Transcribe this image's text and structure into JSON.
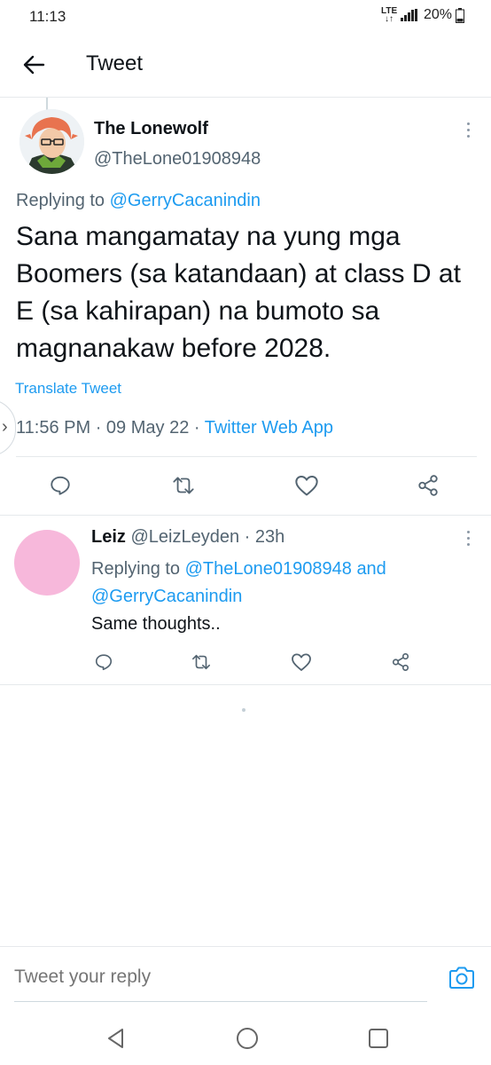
{
  "status_bar": {
    "time": "11:13",
    "network": "LTE",
    "battery": "20%"
  },
  "header": {
    "title": "Tweet",
    "back_icon": "arrow-left-icon"
  },
  "tweet": {
    "author_name": "The Lonewolf",
    "author_handle": "@TheLone01908948",
    "replying_prefix": "Replying to",
    "replying_to": "@GerryCacanindin",
    "text": "Sana mangamatay na yung mga Boomers (sa katandaan) at class D at E (sa kahirapan) na bumoto sa magnanakaw before 2028.",
    "translate_label": "Translate Tweet",
    "time": "11:56 PM",
    "date": "09 May 22",
    "source": "Twitter Web App",
    "separator": "·"
  },
  "reply": {
    "author_name": "Leiz",
    "author_handle": "@LeizLeyden",
    "separator": "·",
    "age": "23h",
    "replying_prefix": "Replying to",
    "replying_to_1": "@TheLone01908948",
    "replying_and": "and",
    "replying_to_2": "@GerryCacanindin",
    "text": "Same thoughts.."
  },
  "composer": {
    "placeholder": "Tweet your reply"
  },
  "colors": {
    "accent": "#1d9bf0",
    "secondary_text": "#536471",
    "primary_text": "#0f1419",
    "divider": "#e6e9ec",
    "reply_avatar": "#f7b8db"
  },
  "icons": {
    "reply": "comment-icon",
    "retweet": "retweet-icon",
    "like": "heart-icon",
    "share": "share-icon",
    "more": "more-vertical-icon",
    "camera": "camera-icon",
    "nav_back": "nav-back-triangle-icon",
    "nav_home": "nav-home-circle-icon",
    "nav_recents": "nav-recents-square-icon"
  }
}
